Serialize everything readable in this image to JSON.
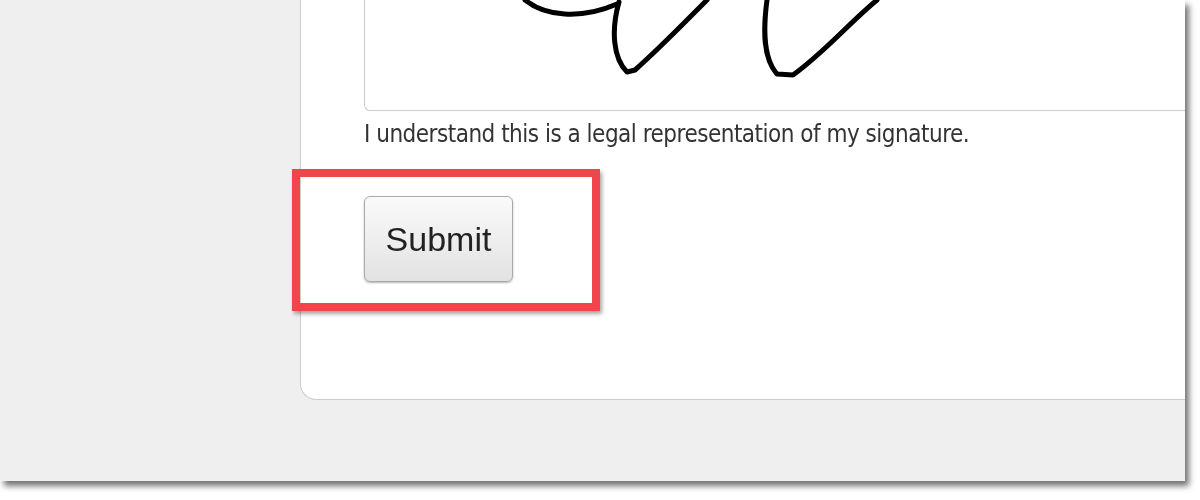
{
  "signature_pad": {
    "kind": "drawn"
  },
  "signature_note": "I understand this is a legal representation of my signature.",
  "submit_button": {
    "label": "Submit",
    "highlighted": true
  }
}
